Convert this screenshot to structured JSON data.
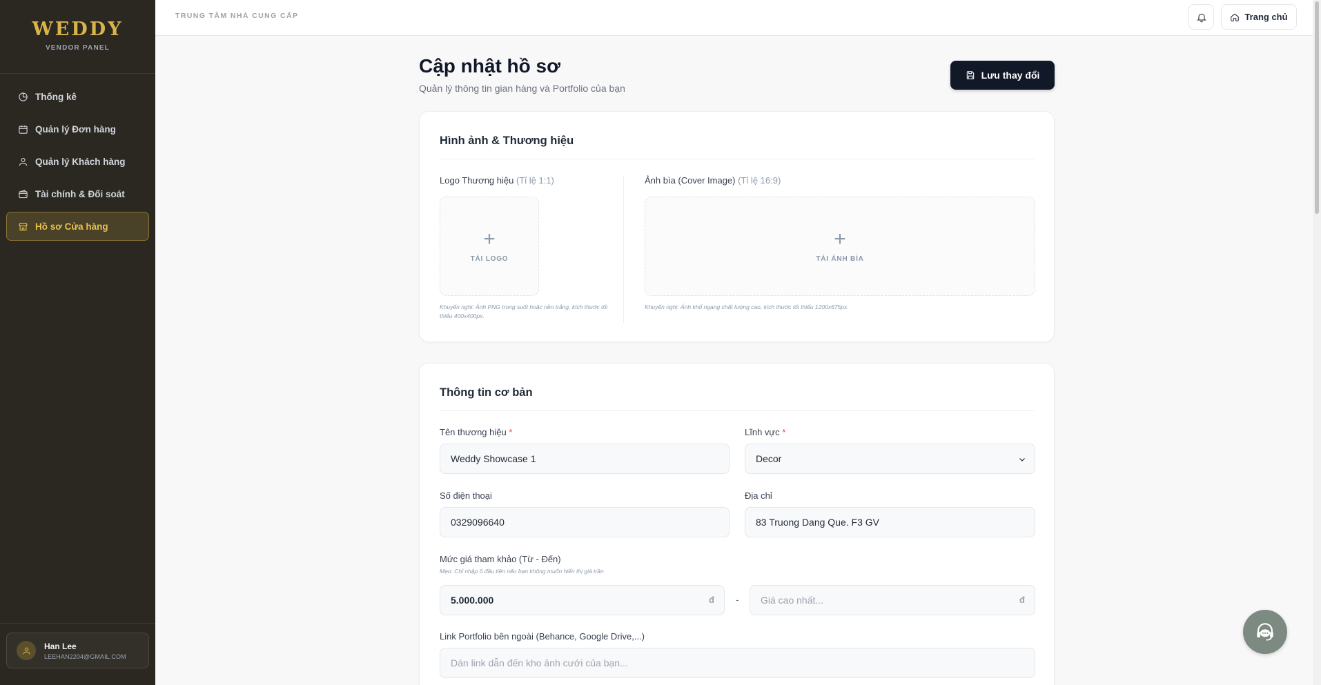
{
  "sidebar": {
    "brand": "WEDDY",
    "brand_sub": "VENDOR PANEL",
    "items": [
      {
        "label": "Thống kê",
        "icon": "pie-chart-icon",
        "active": false
      },
      {
        "label": "Quản lý Đơn hàng",
        "icon": "calendar-icon",
        "active": false
      },
      {
        "label": "Quản lý Khách hàng",
        "icon": "user-icon",
        "active": false
      },
      {
        "label": "Tài chính & Đối soát",
        "icon": "wallet-icon",
        "active": false
      },
      {
        "label": "Hồ sơ Cửa hàng",
        "icon": "store-icon",
        "active": true
      }
    ],
    "user": {
      "name": "Han Lee",
      "email": "LEEHAN2204@GMAIL.COM"
    }
  },
  "topbar": {
    "title": "TRUNG TÂM NHÀ CUNG CẤP",
    "home_label": "Trang chủ"
  },
  "header": {
    "title": "Cập nhật hồ sơ",
    "subtitle": "Quản lý thông tin gian hàng và Portfolio của bạn",
    "save_label": "Lưu thay đổi"
  },
  "branding": {
    "title": "Hình ảnh & Thương hiệu",
    "logo_label": "Logo Thương hiệu",
    "logo_hint": "(Tỉ lệ 1:1)",
    "logo_upload": "TẢI LOGO",
    "logo_note": "Khuyến nghị: Ảnh PNG trong suốt hoặc nền trắng, kích thước tối thiểu 400x400px.",
    "cover_label": "Ảnh bìa (Cover Image)",
    "cover_hint": "(Tỉ lệ 16:9)",
    "cover_upload": "TẢI ẢNH BÌA",
    "cover_note": "Khuyến nghị: Ảnh khổ ngang chất lượng cao, kích thước tối thiểu 1200x675px."
  },
  "basic": {
    "title": "Thông tin cơ bản",
    "brand_name_label": "Tên thương hiệu",
    "brand_name_value": "Weddy Showcase 1",
    "category_label": "Lĩnh vực",
    "category_value": "Decor",
    "phone_label": "Số điện thoại",
    "phone_value": "0329096640",
    "address_label": "Địa chỉ",
    "address_value": "83 Truong Dang Que. F3 GV",
    "price_label": "Mức giá tham khảo (Từ - Đến)",
    "price_tip": "Mẹo: Chỉ nhập ô đầu tiên nếu bạn không muốn hiển thị giá trần",
    "price_min_value": "5.000.000",
    "price_max_placeholder": "Giá cao nhất...",
    "currency": "đ",
    "range_sep": "-",
    "portfolio_label": "Link Portfolio bên ngoài (Behance, Google Drive,...)",
    "portfolio_placeholder": "Dán link dẫn đến kho ảnh cưới của bạn..."
  },
  "colors": {
    "sidebar_bg": "#2b2822",
    "accent_gold": "#d9b44a",
    "primary_button": "#111827",
    "required": "#ef4444"
  }
}
